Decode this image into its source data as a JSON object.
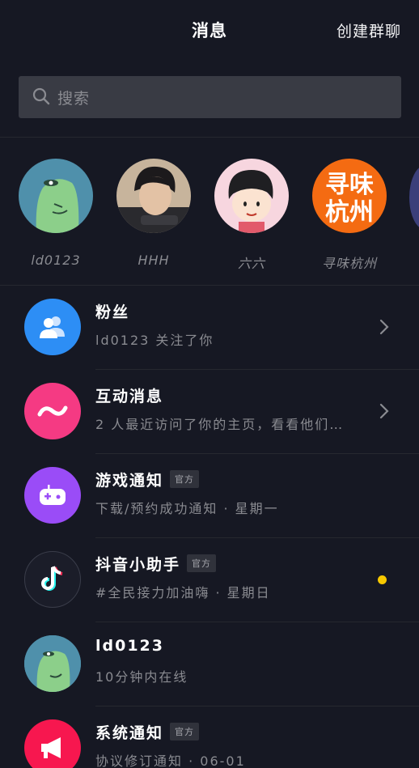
{
  "header": {
    "title": "消息",
    "create_group": "创建群聊"
  },
  "search": {
    "placeholder": "搜索"
  },
  "friends": [
    {
      "name": "ld0123",
      "avatar": "green-cartoon"
    },
    {
      "name": "HHH",
      "avatar": "person-photo"
    },
    {
      "name": "六六",
      "avatar": "cartoon-girl"
    },
    {
      "name": "寻味杭州",
      "avatar": "text-logo",
      "logo_text": "寻味杭州"
    }
  ],
  "messages": [
    {
      "title": "粉丝",
      "subtitle": "ld0123 关注了你",
      "icon": "fans-icon",
      "color": "#2d8ef5",
      "right": "chevron"
    },
    {
      "title": "互动消息",
      "subtitle": "2 人最近访问了你的主页，看看他们…",
      "icon": "interaction-icon",
      "color": "#f53a83",
      "right": "chevron"
    },
    {
      "title": "游戏通知",
      "badge": "官方",
      "subtitle": "下载/预约成功通知 · 星期一",
      "icon": "game-controller-icon",
      "color": "#9a4cf7",
      "right": ""
    },
    {
      "title": "抖音小助手",
      "badge": "官方",
      "subtitle": "#全民接力加油嗨 · 星期日",
      "icon": "tiktok-icon",
      "color": "#1b1d29",
      "right": "dot"
    },
    {
      "title": "ld0123",
      "subtitle": "10分钟内在线",
      "icon": "green-cartoon",
      "color": "#4a8aa8",
      "right": ""
    },
    {
      "title": "系统通知",
      "badge": "官方",
      "subtitle": "协议修订通知 · 06-01",
      "icon": "megaphone-icon",
      "color": "#f7174f",
      "right": ""
    }
  ],
  "colors": {
    "background": "#161823",
    "unread_dot": "#f7c800"
  }
}
